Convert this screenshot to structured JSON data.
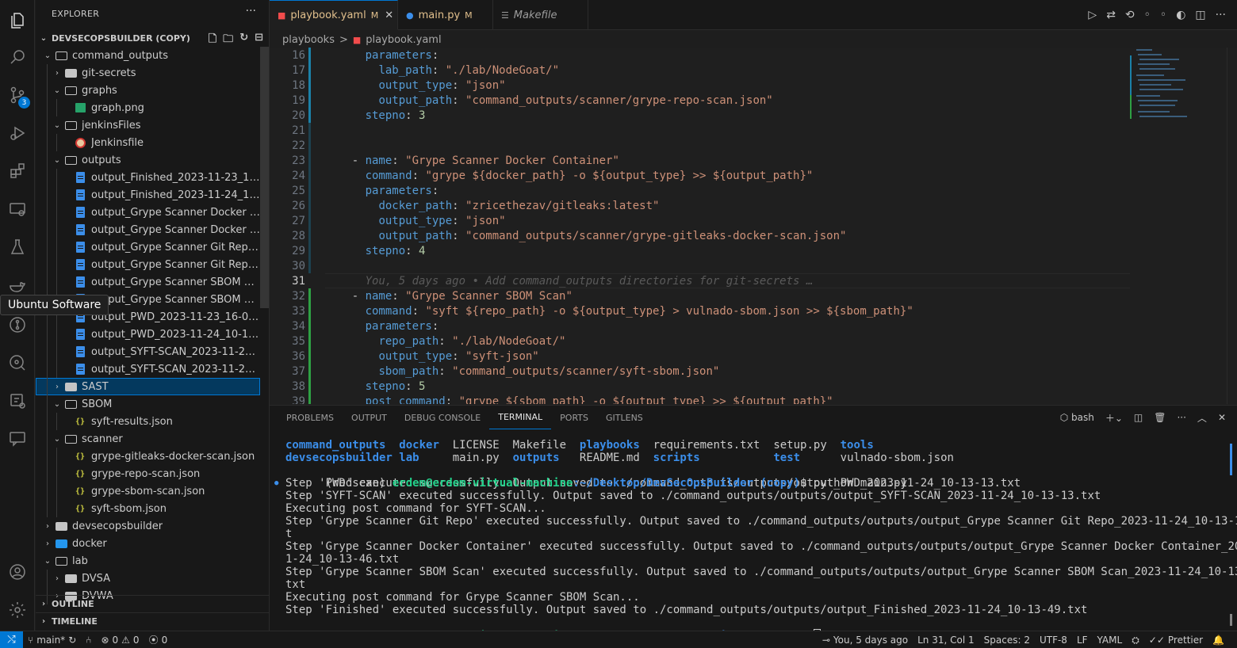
{
  "sidebar": {
    "title": "EXPLORER",
    "more": "···",
    "root": "DEVSECOPSBUILDER (COPY)",
    "tree": [
      {
        "label": "command_outputs",
        "depth": 1,
        "kind": "folder",
        "open": true
      },
      {
        "label": "git-secrets",
        "depth": 2,
        "kind": "folder",
        "open": false
      },
      {
        "label": "graphs",
        "depth": 2,
        "kind": "folder",
        "open": true
      },
      {
        "label": "graph.png",
        "depth": 3,
        "kind": "png"
      },
      {
        "label": "jenkinsFiles",
        "depth": 2,
        "kind": "folder",
        "open": true
      },
      {
        "label": "Jenkinsfile",
        "depth": 3,
        "kind": "jenkins"
      },
      {
        "label": "outputs",
        "depth": 2,
        "kind": "folder",
        "open": true
      },
      {
        "label": "output_Finished_2023-11-23_16-04...",
        "depth": 3,
        "kind": "file"
      },
      {
        "label": "output_Finished_2023-11-24_10-13...",
        "depth": 3,
        "kind": "file"
      },
      {
        "label": "output_Grype Scanner Docker Cont...",
        "depth": 3,
        "kind": "file"
      },
      {
        "label": "output_Grype Scanner Docker Cont...",
        "depth": 3,
        "kind": "file"
      },
      {
        "label": "output_Grype Scanner Git Repo_20...",
        "depth": 3,
        "kind": "file"
      },
      {
        "label": "output_Grype Scanner Git Repo_20...",
        "depth": 3,
        "kind": "file"
      },
      {
        "label": "output_Grype Scanner SBOM Scan_...",
        "depth": 3,
        "kind": "file"
      },
      {
        "label": "output_Grype Scanner SBOM Scan_...",
        "depth": 3,
        "kind": "file"
      },
      {
        "label": "output_PWD_2023-11-23_16-04-24...",
        "depth": 3,
        "kind": "file"
      },
      {
        "label": "output_PWD_2023-11-24_10-13-13...",
        "depth": 3,
        "kind": "file"
      },
      {
        "label": "output_SYFT-SCAN_2023-11-23_16...",
        "depth": 3,
        "kind": "file"
      },
      {
        "label": "output_SYFT-SCAN_2023-11-24_10...",
        "depth": 3,
        "kind": "file"
      },
      {
        "label": "SAST",
        "depth": 2,
        "kind": "folder",
        "open": false,
        "selected": true
      },
      {
        "label": "SBOM",
        "depth": 2,
        "kind": "folder",
        "open": true
      },
      {
        "label": "syft-results.json",
        "depth": 3,
        "kind": "json"
      },
      {
        "label": "scanner",
        "depth": 2,
        "kind": "folder",
        "open": true
      },
      {
        "label": "grype-gitleaks-docker-scan.json",
        "depth": 3,
        "kind": "json"
      },
      {
        "label": "grype-repo-scan.json",
        "depth": 3,
        "kind": "json"
      },
      {
        "label": "grype-sbom-scan.json",
        "depth": 3,
        "kind": "json"
      },
      {
        "label": "syft-sbom.json",
        "depth": 3,
        "kind": "json"
      },
      {
        "label": "devsecopsbuilder",
        "depth": 1,
        "kind": "folder",
        "open": false
      },
      {
        "label": "docker",
        "depth": 1,
        "kind": "docker",
        "open": false
      },
      {
        "label": "lab",
        "depth": 1,
        "kind": "folder",
        "open": true
      },
      {
        "label": "DVSA",
        "depth": 2,
        "kind": "folder",
        "open": false
      },
      {
        "label": "DVWA",
        "depth": 2,
        "kind": "folder",
        "open": false
      }
    ],
    "outline": "OUTLINE",
    "timeline": "TIMELINE"
  },
  "tooltip": "Ubuntu Software",
  "activity": {
    "scm_badge": "3"
  },
  "tabs": [
    {
      "label": "playbook.yaml",
      "mod": "M",
      "active": true
    },
    {
      "label": "main.py",
      "mod": "M",
      "active": false
    },
    {
      "label": "Makefile",
      "mod": "",
      "active": false
    }
  ],
  "breadcrumb": [
    "playbooks",
    ">",
    "playbook.yaml"
  ],
  "code": {
    "lines": [
      {
        "n": "16",
        "indent": "      ",
        "parts": [
          [
            "k",
            "parameters"
          ],
          [
            "p",
            ":"
          ]
        ]
      },
      {
        "n": "17",
        "indent": "        ",
        "parts": [
          [
            "k",
            "lab_path"
          ],
          [
            "p",
            ": "
          ],
          [
            "s",
            "\"./lab/NodeGoat/\""
          ]
        ]
      },
      {
        "n": "18",
        "indent": "        ",
        "parts": [
          [
            "k",
            "output_type"
          ],
          [
            "p",
            ": "
          ],
          [
            "s",
            "\"json\""
          ]
        ]
      },
      {
        "n": "19",
        "indent": "        ",
        "parts": [
          [
            "k",
            "output_path"
          ],
          [
            "p",
            ": "
          ],
          [
            "s",
            "\"command_outputs/scanner/grype-repo-scan.json\""
          ]
        ]
      },
      {
        "n": "20",
        "indent": "      ",
        "parts": [
          [
            "k",
            "stepno"
          ],
          [
            "p",
            ": "
          ],
          [
            "n",
            "3"
          ]
        ]
      },
      {
        "n": "21",
        "indent": "",
        "parts": []
      },
      {
        "n": "22",
        "indent": "",
        "parts": []
      },
      {
        "n": "23",
        "indent": "    ",
        "parts": [
          [
            "p",
            "- "
          ],
          [
            "k",
            "name"
          ],
          [
            "p",
            ": "
          ],
          [
            "s",
            "\"Grype Scanner Docker Container\""
          ]
        ]
      },
      {
        "n": "24",
        "indent": "      ",
        "parts": [
          [
            "k",
            "command"
          ],
          [
            "p",
            ": "
          ],
          [
            "s",
            "\"grype ${docker_path} -o ${output_type} >> ${output_path}\""
          ]
        ]
      },
      {
        "n": "25",
        "indent": "      ",
        "parts": [
          [
            "k",
            "parameters"
          ],
          [
            "p",
            ":"
          ]
        ]
      },
      {
        "n": "26",
        "indent": "        ",
        "parts": [
          [
            "k",
            "docker_path"
          ],
          [
            "p",
            ": "
          ],
          [
            "s",
            "\"zricethezav/gitleaks:latest\""
          ]
        ]
      },
      {
        "n": "27",
        "indent": "        ",
        "parts": [
          [
            "k",
            "output_type"
          ],
          [
            "p",
            ": "
          ],
          [
            "s",
            "\"json\""
          ]
        ]
      },
      {
        "n": "28",
        "indent": "        ",
        "parts": [
          [
            "k",
            "output_path"
          ],
          [
            "p",
            ": "
          ],
          [
            "s",
            "\"command_outputs/scanner/grype-gitleaks-docker-scan.json\""
          ]
        ]
      },
      {
        "n": "29",
        "indent": "      ",
        "parts": [
          [
            "k",
            "stepno"
          ],
          [
            "p",
            ": "
          ],
          [
            "n",
            "4"
          ]
        ]
      },
      {
        "n": "30",
        "indent": "",
        "parts": []
      },
      {
        "n": "31",
        "indent": "      ",
        "parts": [
          [
            "b",
            "You, 5 days ago • Add command_outputs directories for git-secrets …"
          ]
        ],
        "current": true
      },
      {
        "n": "32",
        "indent": "    ",
        "parts": [
          [
            "p",
            "- "
          ],
          [
            "k",
            "name"
          ],
          [
            "p",
            ": "
          ],
          [
            "s",
            "\"Grype Scanner SBOM Scan\""
          ]
        ]
      },
      {
        "n": "33",
        "indent": "      ",
        "parts": [
          [
            "k",
            "command"
          ],
          [
            "p",
            ": "
          ],
          [
            "s",
            "\"syft ${repo_path} -o ${output_type} > vulnado-sbom.json >> ${sbom_path}\""
          ]
        ]
      },
      {
        "n": "34",
        "indent": "      ",
        "parts": [
          [
            "k",
            "parameters"
          ],
          [
            "p",
            ":"
          ]
        ]
      },
      {
        "n": "35",
        "indent": "        ",
        "parts": [
          [
            "k",
            "repo_path"
          ],
          [
            "p",
            ": "
          ],
          [
            "s",
            "\"./lab/NodeGoat/\""
          ]
        ]
      },
      {
        "n": "36",
        "indent": "        ",
        "parts": [
          [
            "k",
            "output_type"
          ],
          [
            "p",
            ": "
          ],
          [
            "s",
            "\"syft-json\""
          ]
        ]
      },
      {
        "n": "37",
        "indent": "        ",
        "parts": [
          [
            "k",
            "sbom_path"
          ],
          [
            "p",
            ": "
          ],
          [
            "s",
            "\"command_outputs/scanner/syft-sbom.json\""
          ]
        ]
      },
      {
        "n": "38",
        "indent": "      ",
        "parts": [
          [
            "k",
            "stepno"
          ],
          [
            "p",
            ": "
          ],
          [
            "n",
            "5"
          ]
        ]
      },
      {
        "n": "39",
        "indent": "      ",
        "parts": [
          [
            "k",
            "post_command"
          ],
          [
            "p",
            ": "
          ],
          [
            "s",
            "\"grype ${sbom_path} -o ${output_type} >> ${output_path}\""
          ]
        ]
      }
    ]
  },
  "panel": {
    "tabs": [
      "PROBLEMS",
      "OUTPUT",
      "DEBUG CONSOLE",
      "TERMINAL",
      "PORTS",
      "GITLENS"
    ],
    "active_tab": "TERMINAL",
    "shell": "bash"
  },
  "terminal": {
    "ls_row1": [
      [
        "d",
        "command_outputs"
      ],
      [
        "t",
        "  "
      ],
      [
        "d",
        "docker"
      ],
      [
        "t",
        "  LICENSE  Makefile  "
      ],
      [
        "d",
        "playbooks"
      ],
      [
        "t",
        "  requirements.txt  setup.py  "
      ],
      [
        "d",
        "tools"
      ]
    ],
    "ls_row2": [
      [
        "d",
        "devsecopsbuilder"
      ],
      [
        "t",
        " "
      ],
      [
        "d",
        "lab"
      ],
      [
        "t",
        "     main.py  "
      ],
      [
        "d",
        "outputs"
      ],
      [
        "t",
        "   README.md  "
      ],
      [
        "d",
        "scripts"
      ],
      [
        "t",
        "           "
      ],
      [
        "d",
        "test"
      ],
      [
        "t",
        "      vulnado-sbom.json"
      ]
    ],
    "prompt_env": "(redscan) ",
    "prompt_user": "erdem@erdem-virtual-machine",
    "prompt_path": ":~/Desktop/DevSecOpsBuilder (copy)",
    "prompt_sign": "$ ",
    "command": "python main.py",
    "output": [
      "Step 'PWD' executed successfully. Output saved to ./command_outputs/outputs/output_PWD_2023-11-24_10-13-13.txt",
      "Step 'SYFT-SCAN' executed successfully. Output saved to ./command_outputs/outputs/output_SYFT-SCAN_2023-11-24_10-13-13.txt",
      "Executing post command for SYFT-SCAN...",
      "Step 'Grype Scanner Git Repo' executed successfully. Output saved to ./command_outputs/outputs/output_Grype Scanner Git Repo_2023-11-24_10-13-14.tx",
      "t",
      "Step 'Grype Scanner Docker Container' executed successfully. Output saved to ./command_outputs/outputs/output_Grype Scanner Docker Container_2023-1",
      "1-24_10-13-46.txt",
      "Step 'Grype Scanner SBOM Scan' executed successfully. Output saved to ./command_outputs/outputs/output_Grype Scanner SBOM Scan_2023-11-24_10-13-47.",
      "txt",
      "Executing post command for Grype Scanner SBOM Scan...",
      "Step 'Finished' executed successfully. Output saved to ./command_outputs/outputs/output_Finished_2023-11-24_10-13-49.txt"
    ]
  },
  "status": {
    "branch": "main*",
    "errors": "0",
    "warnings": "0",
    "ports": "0",
    "blame": "You, 5 days ago",
    "position": "Ln 31, Col 1",
    "spaces": "Spaces: 2",
    "encoding": "UTF-8",
    "eol": "LF",
    "language": "YAML",
    "formatter": "Prettier"
  },
  "colors": {
    "accent": "#0078d4",
    "string": "#ce9178",
    "key": "#569cd6",
    "number": "#b5cea8",
    "git_added": "#2ea043",
    "git_modified": "#1b81a8"
  }
}
